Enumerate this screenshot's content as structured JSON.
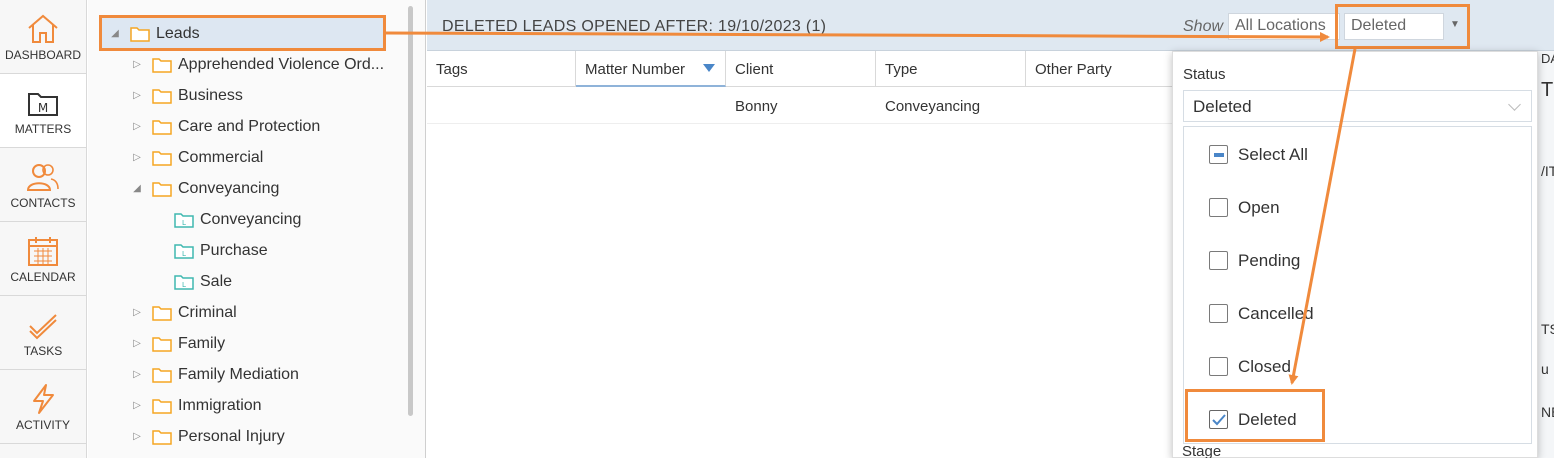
{
  "nav": {
    "items": [
      {
        "label": "DASHBOARD",
        "icon": "home-icon"
      },
      {
        "label": "MATTERS",
        "icon": "matters-icon"
      },
      {
        "label": "CONTACTS",
        "icon": "contacts-icon"
      },
      {
        "label": "CALENDAR",
        "icon": "calendar-icon"
      },
      {
        "label": "TASKS",
        "icon": "tasks-icon"
      },
      {
        "label": "ACTIVITY",
        "icon": "activity-icon"
      }
    ]
  },
  "tree": {
    "root": "Leads",
    "items": [
      "Apprehended Violence Ord...",
      "Business",
      "Care and Protection",
      "Commercial",
      "Conveyancing",
      "Conveyancing",
      "Purchase",
      "Sale",
      "Criminal",
      "Family",
      "Family Mediation",
      "Immigration",
      "Personal Injury"
    ]
  },
  "header": {
    "title": "DELETED LEADS OPENED AFTER: 19/10/2023  (1)",
    "show_label": "Show",
    "location_value": "All Locations",
    "status_value": "Deleted"
  },
  "table": {
    "columns": [
      "Tags",
      "Matter Number",
      "Client",
      "Type",
      "Other Party"
    ],
    "rows": [
      [
        "",
        "",
        "Bonny",
        "Conveyancing",
        ""
      ]
    ]
  },
  "dropdown": {
    "status_label": "Status",
    "selected": "Deleted",
    "options": [
      {
        "label": "Select All",
        "state": "partial"
      },
      {
        "label": "Open",
        "state": "unchecked"
      },
      {
        "label": "Pending",
        "state": "unchecked"
      },
      {
        "label": "Cancelled",
        "state": "unchecked"
      },
      {
        "label": "Closed",
        "state": "unchecked"
      },
      {
        "label": "Deleted",
        "state": "checked"
      }
    ],
    "stage_label": "Stage"
  },
  "sliver": [
    "DA",
    "T",
    "/IT",
    "TS",
    "u",
    "NE"
  ],
  "colors": {
    "accent_orange": "#f08a3c",
    "header_bg": "#dfe8f1",
    "checkbox_blue": "#4a86c8",
    "folder_orange": "#f5a623",
    "folder_teal": "#3fb8b0"
  }
}
